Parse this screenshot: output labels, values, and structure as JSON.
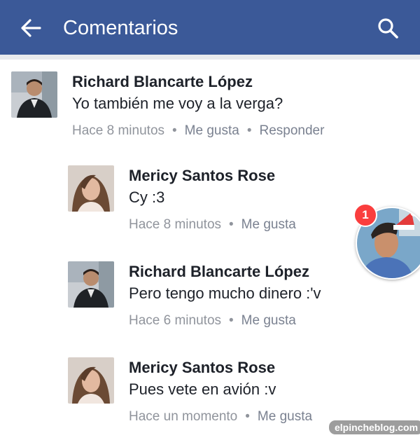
{
  "header": {
    "title": "Comentarios",
    "back_icon": "arrow-left-icon",
    "search_icon": "search-icon",
    "background_color": "#3b5998"
  },
  "comments": [
    {
      "author": "Richard Blancarte López",
      "text": "Yo también me voy a la verga?",
      "time": "Hace 8 minutos",
      "like": "Me gusta",
      "reply": "Responder"
    },
    {
      "author": "Mericy Santos Rose",
      "text": "Cy :3",
      "time": "Hace 8 minutos",
      "like": "Me gusta"
    },
    {
      "author": "Richard Blancarte López",
      "text": "Pero tengo mucho dinero :'v",
      "time": "Hace 6 minutos",
      "like": "Me gusta"
    },
    {
      "author": "Mericy Santos Rose",
      "text": "Pues vete en avión :v",
      "time": "Hace un momento",
      "like": "Me gusta"
    }
  ],
  "chathead": {
    "badge_count": "1"
  },
  "watermark": "elpincheblog.com"
}
